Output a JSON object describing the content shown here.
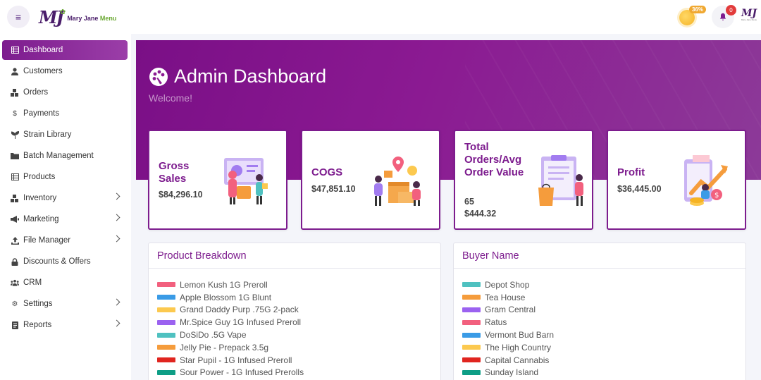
{
  "brand": {
    "logo_mark": "MJ",
    "name_part1": "Mary Jane",
    "name_part2": "Menu",
    "mini_caption": "Mary Jane Menu"
  },
  "topbar": {
    "coin_badge": "36%",
    "notification_count": "0"
  },
  "sidebar": {
    "items": [
      {
        "label": "Dashboard",
        "icon": "table-icon",
        "active": true
      },
      {
        "label": "Customers",
        "icon": "user-icon"
      },
      {
        "label": "Orders",
        "icon": "boxes-icon"
      },
      {
        "label": "Payments",
        "icon": "dollar-icon"
      },
      {
        "label": "Strain Library",
        "icon": "seedling-icon"
      },
      {
        "label": "Batch Management",
        "icon": "folder-icon"
      },
      {
        "label": "Products",
        "icon": "list-icon"
      },
      {
        "label": "Inventory",
        "icon": "boxes-icon",
        "submenu": true
      },
      {
        "label": "Marketing",
        "icon": "megaphone-icon",
        "submenu": true
      },
      {
        "label": "File Manager",
        "icon": "upload-icon",
        "submenu": true
      },
      {
        "label": "Discounts & Offers",
        "icon": "lock-icon"
      },
      {
        "label": "CRM",
        "icon": "users-icon"
      },
      {
        "label": "Settings",
        "icon": "gear-icon",
        "submenu": true
      },
      {
        "label": "Reports",
        "icon": "report-icon",
        "submenu": true
      }
    ]
  },
  "hero": {
    "title": "Admin Dashboard",
    "subtitle": "Welcome!"
  },
  "cards": [
    {
      "title": "Gross Sales",
      "values": [
        "$84,296.10"
      ]
    },
    {
      "title": "COGS",
      "values": [
        "$47,851.10"
      ]
    },
    {
      "title": "Total Orders/Avg Order Value",
      "values": [
        "65",
        "$444.32"
      ]
    },
    {
      "title": "Profit",
      "values": [
        "$36,445.00"
      ]
    }
  ],
  "product_breakdown": {
    "title": "Product Breakdown",
    "items": [
      {
        "label": "Lemon Kush 1G Preroll",
        "color": "#f2607e"
      },
      {
        "label": "Apple Blossom 1G Blunt",
        "color": "#3a9be6"
      },
      {
        "label": "Grand Daddy Purp .75G 2-pack",
        "color": "#fcc94f"
      },
      {
        "label": "Mr.Spice Guy 1G Infused Preroll",
        "color": "#9b62f0"
      },
      {
        "label": "DoSiDo .5G Vape",
        "color": "#4fc1c0"
      },
      {
        "label": "Jelly Pie - Prepack 3.5g",
        "color": "#f59c3c"
      },
      {
        "label": "Star Pupil - 1G Infused Preroll",
        "color": "#e0251f"
      },
      {
        "label": "Sour Power - 1G Infused Prerolls",
        "color": "#0e9e86"
      }
    ]
  },
  "buyer_name": {
    "title": "Buyer Name",
    "items": [
      {
        "label": "Depot Shop",
        "color": "#4fc1c0"
      },
      {
        "label": "Tea House",
        "color": "#f59c3c"
      },
      {
        "label": "Gram Central",
        "color": "#9b62f0"
      },
      {
        "label": "Ratus",
        "color": "#f2607e"
      },
      {
        "label": "Vermont Bud Barn",
        "color": "#3a9be6"
      },
      {
        "label": "The High Country",
        "color": "#fcc94f"
      },
      {
        "label": "Capital Cannabis",
        "color": "#e0251f"
      },
      {
        "label": "Sunday Island",
        "color": "#0e9e86"
      }
    ]
  }
}
